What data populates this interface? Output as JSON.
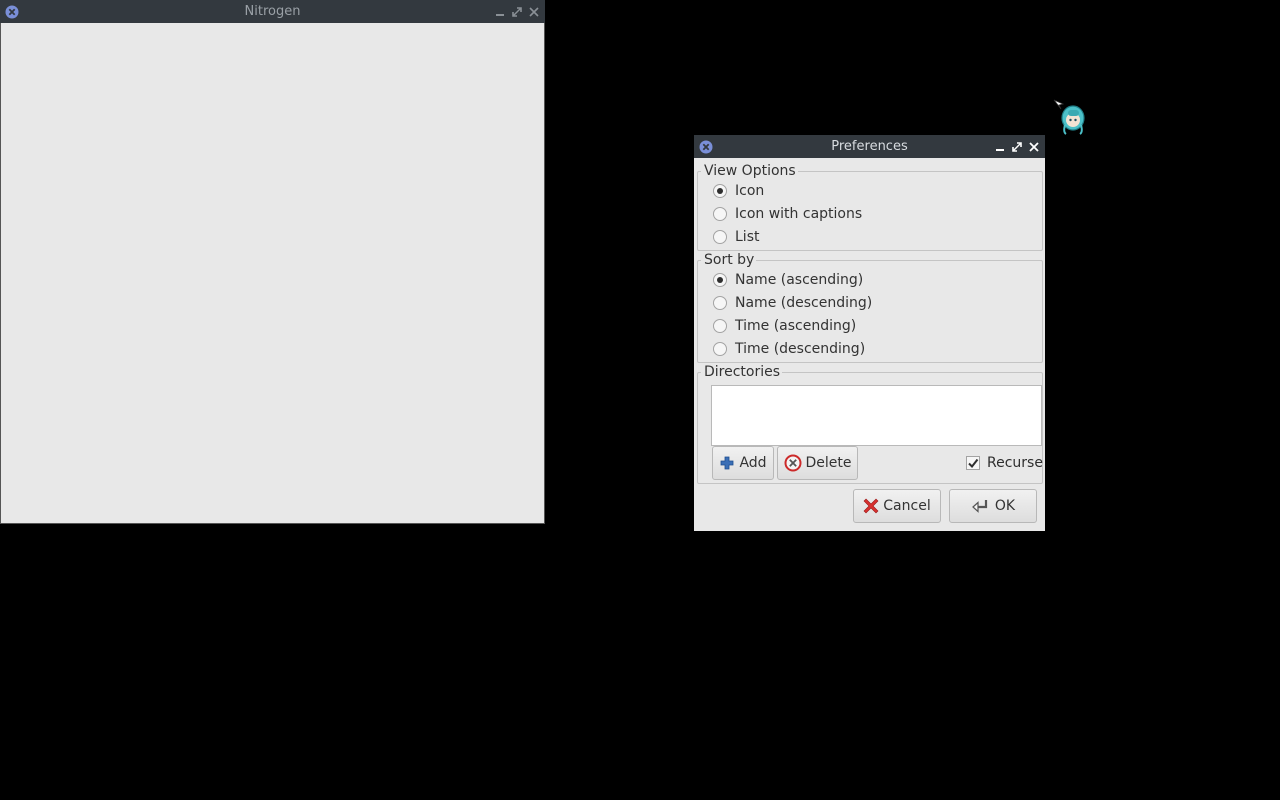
{
  "nitrogen_window": {
    "title": "Nitrogen"
  },
  "preferences_window": {
    "title": "Preferences",
    "view_options": {
      "legend": "View Options",
      "options": [
        {
          "label": "Icon",
          "checked": true
        },
        {
          "label": "Icon with captions",
          "checked": false
        },
        {
          "label": "List",
          "checked": false
        }
      ]
    },
    "sort_by": {
      "legend": "Sort by",
      "options": [
        {
          "label": "Name (ascending)",
          "checked": true
        },
        {
          "label": "Name (descending)",
          "checked": false
        },
        {
          "label": "Time (ascending)",
          "checked": false
        },
        {
          "label": "Time (descending)",
          "checked": false
        }
      ]
    },
    "directories": {
      "legend": "Directories",
      "items": [],
      "add_label": "Add",
      "delete_label": "Delete",
      "recurse_label": "Recurse",
      "recurse_checked": true
    },
    "cancel_label": "Cancel",
    "ok_label": "OK"
  },
  "icons": {
    "window_menu": "window-menu-icon",
    "minimize": "minimize-icon",
    "maximize": "maximize-icon",
    "close": "close-icon",
    "add": "plus-icon",
    "delete": "delete-circle-icon",
    "cancel": "red-x-icon",
    "ok": "enter-arrow-icon",
    "cursor": "mascot-cursor-icon"
  },
  "colors": {
    "desktop": "#000000",
    "titlebar": "#33393f",
    "window_bg": "#e8e8e8",
    "wm_icon": "#7a8fd8",
    "add_icon": "#3b6fb6",
    "delete_icon": "#cc2a2a",
    "cursor_teal": "#4bc0c8"
  }
}
